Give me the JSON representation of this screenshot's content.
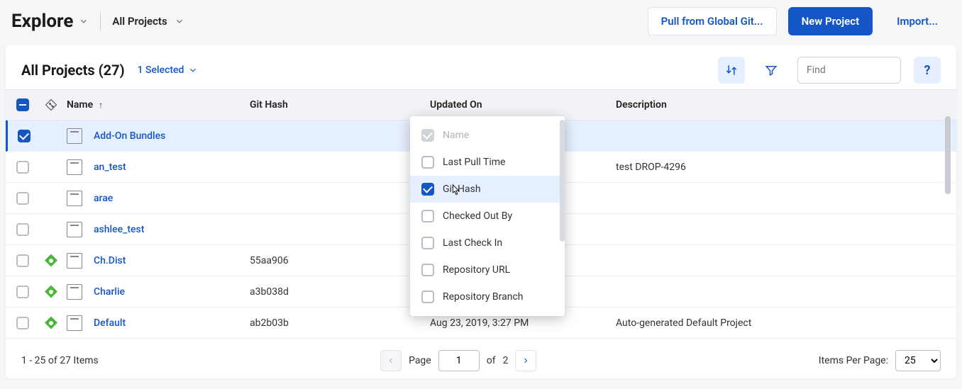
{
  "header": {
    "title": "Explore",
    "breadcrumb": "All Projects",
    "pullBtn": "Pull from Global Git...",
    "newBtn": "New Project",
    "importBtn": "Import..."
  },
  "listHeader": {
    "title": "All Projects (27)",
    "selected": "1 Selected",
    "findPlaceholder": "Find",
    "help": "?"
  },
  "columns": {
    "name": "Name",
    "hash": "Git Hash",
    "updated": "Updated On",
    "desc": "Description"
  },
  "rows": [
    {
      "name": "Add-On Bundles",
      "hash": "",
      "updated": "",
      "desc": "",
      "selected": true,
      "git": false
    },
    {
      "name": "an_test",
      "hash": "",
      "updated": "",
      "desc": "test DROP-4296",
      "selected": false,
      "git": false
    },
    {
      "name": "arae",
      "hash": "",
      "updated": "",
      "desc": "",
      "selected": false,
      "git": false
    },
    {
      "name": "ashlee_test",
      "hash": "",
      "updated": "",
      "desc": "",
      "selected": false,
      "git": false
    },
    {
      "name": "Ch.Dist",
      "hash": "55aa906",
      "updated": "",
      "desc": "",
      "selected": false,
      "git": true
    },
    {
      "name": "Charlie",
      "hash": "a3b038d",
      "updated": "",
      "desc": "",
      "selected": false,
      "git": true
    },
    {
      "name": "Default",
      "hash": "ab2b03b",
      "updated": "Aug 23, 2019, 3:27 PM",
      "desc": "Auto-generated Default Project",
      "selected": false,
      "git": true
    }
  ],
  "columnChooser": {
    "items": [
      {
        "label": "Name",
        "checked": true,
        "disabled": true
      },
      {
        "label": "Last Pull Time",
        "checked": false,
        "disabled": false
      },
      {
        "label": "Git Hash",
        "checked": true,
        "disabled": false,
        "active": true
      },
      {
        "label": "Checked Out By",
        "checked": false,
        "disabled": false
      },
      {
        "label": "Last Check In",
        "checked": false,
        "disabled": false
      },
      {
        "label": "Repository URL",
        "checked": false,
        "disabled": false
      },
      {
        "label": "Repository Branch",
        "checked": false,
        "disabled": false
      }
    ]
  },
  "footer": {
    "range": "1 - 25 of 27 Items",
    "pageLabel": "Page",
    "page": "1",
    "of": "of",
    "total": "2",
    "ippLabel": "Items Per Page:",
    "ipp": "25"
  }
}
